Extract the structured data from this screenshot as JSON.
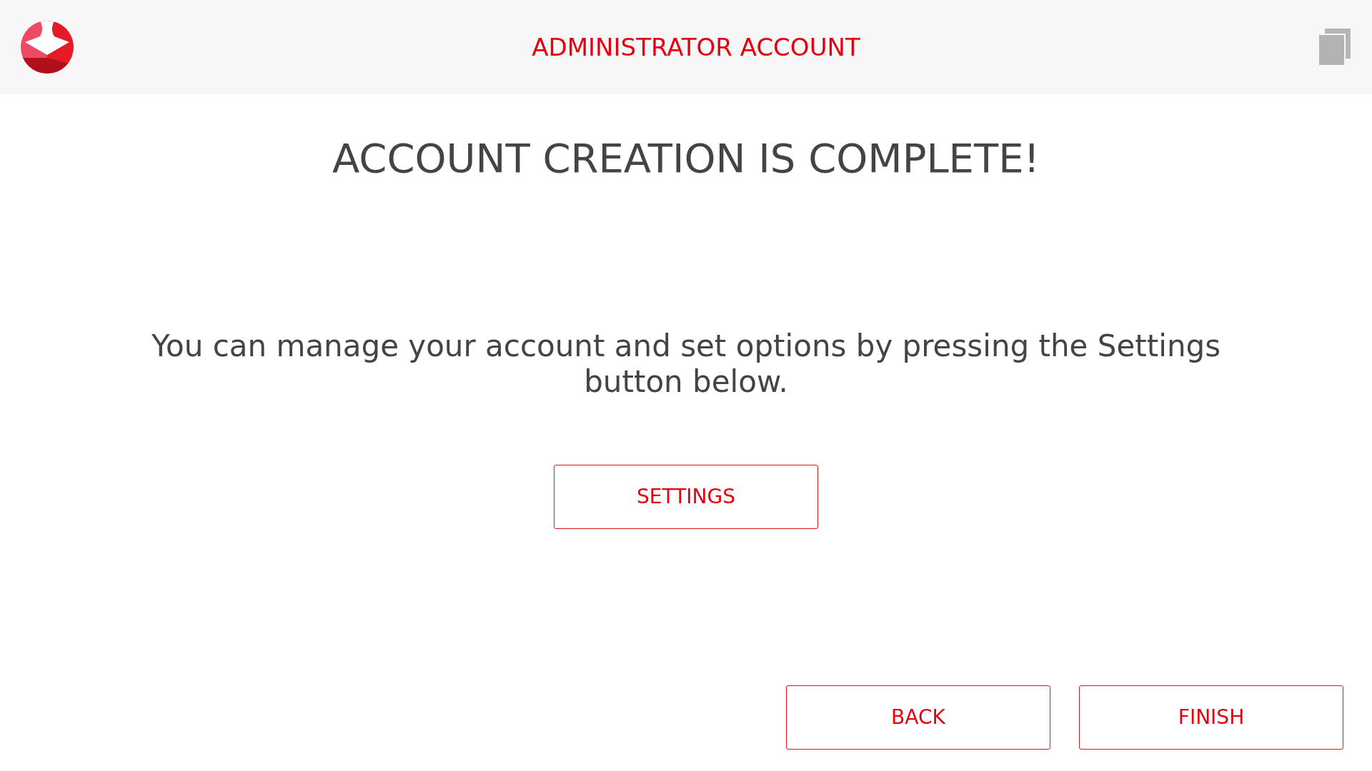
{
  "header": {
    "title": "ADMINISTRATOR ACCOUNT"
  },
  "heading": "ACCOUNT CREATION IS COMPLETE!",
  "message": "You can manage your account and set options by pressing the Settings button below.",
  "settings_button": "SETTINGS",
  "footer_buttons": [
    "BACK",
    "FINISH"
  ]
}
